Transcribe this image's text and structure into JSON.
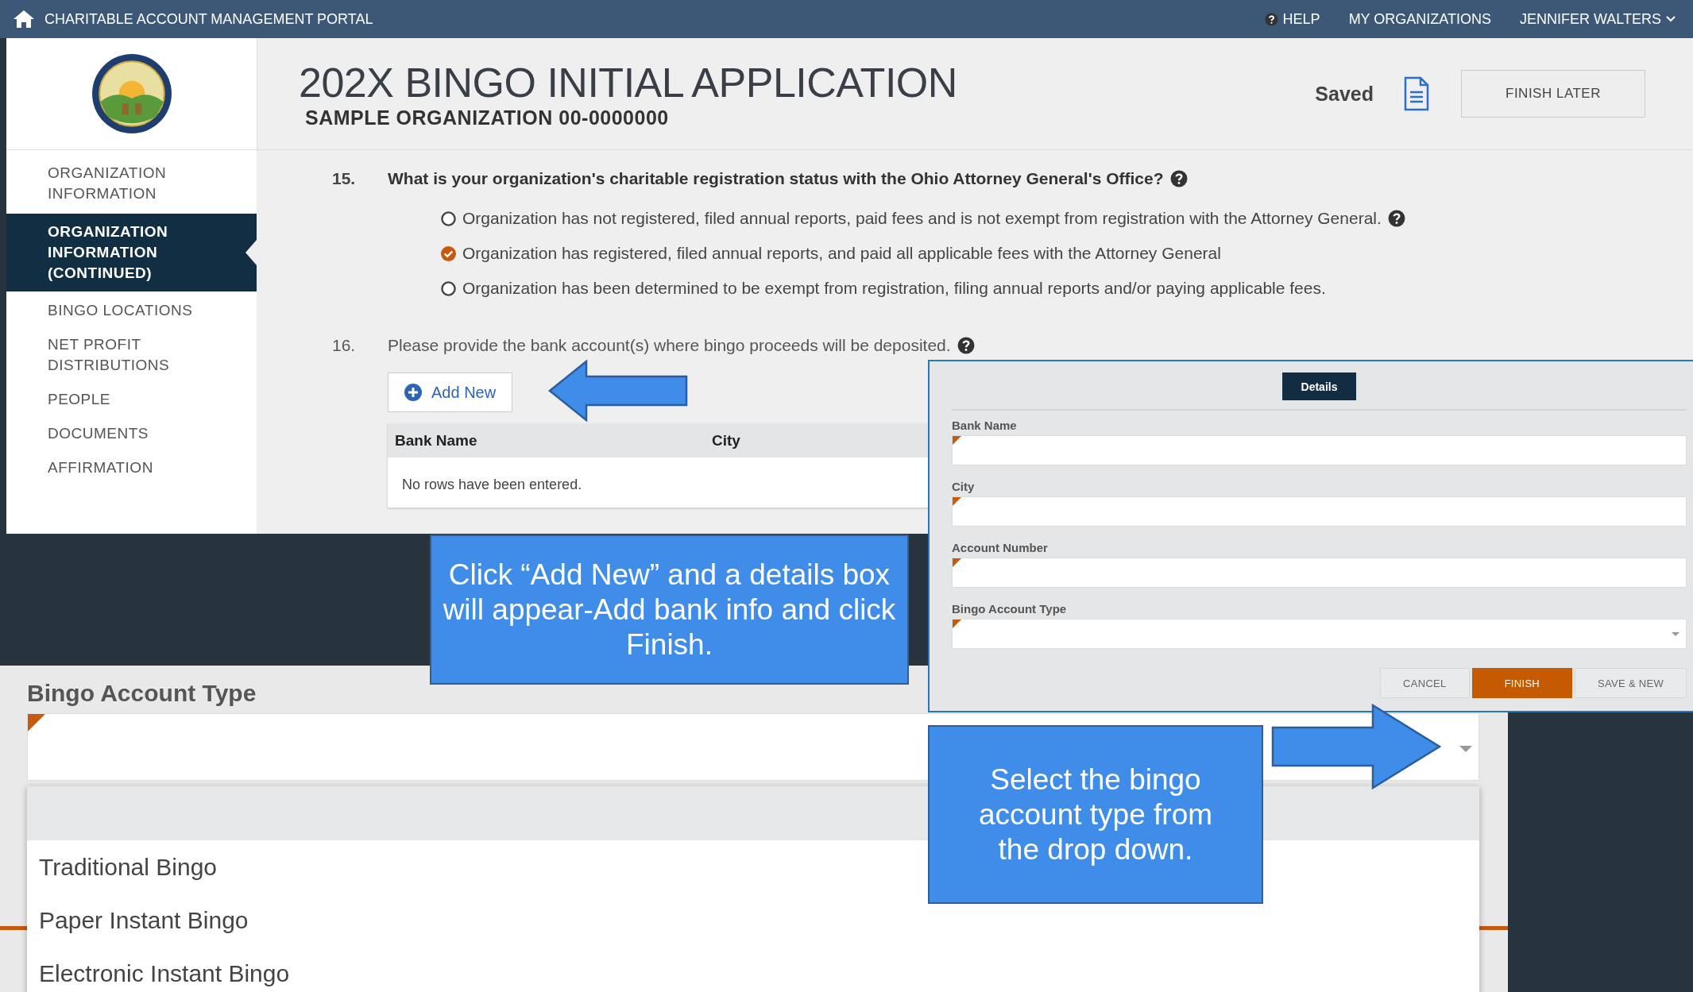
{
  "top_bar": {
    "title": "CHARITABLE ACCOUNT MANAGEMENT PORTAL",
    "help": "HELP",
    "organizations": "MY ORGANIZATIONS",
    "user": "JENNIFER WALTERS"
  },
  "header": {
    "title": "202X BINGO INITIAL APPLICATION",
    "subtitle": "SAMPLE ORGANIZATION 00-0000000",
    "status": "Saved",
    "button": "FINISH LATER"
  },
  "sidebar": {
    "items": [
      {
        "label": "ORGANIZATION INFORMATION",
        "selected": false
      },
      {
        "label": "ORGANIZATION INFORMATION (CONTINUED)",
        "selected": true
      },
      {
        "label": "BINGO LOCATIONS",
        "selected": false
      },
      {
        "label": "NET PROFIT DISTRIBUTIONS",
        "selected": false
      },
      {
        "label": "PEOPLE",
        "selected": false
      },
      {
        "label": "DOCUMENTS",
        "selected": false
      },
      {
        "label": "AFFIRMATION",
        "selected": false
      }
    ]
  },
  "registration_question": {
    "number": "15.",
    "text": "What is your organization's charitable registration status with the Ohio Attorney General's Office?",
    "options": [
      {
        "label": "Organization has not registered, filed annual reports, paid fees and is not exempt from registration with the Attorney General.",
        "selected": false,
        "help": true
      },
      {
        "label": "Organization has registered, filed annual reports, and paid all applicable fees with the Attorney General",
        "selected": true,
        "help": false
      },
      {
        "label": "Organization has been determined to be exempt from registration, filing annual reports and/or paying applicable fees.",
        "selected": false,
        "help": false
      }
    ]
  },
  "bank_question": {
    "number": "16.",
    "text": "Please provide the bank account(s) where bingo proceeds will be deposited.",
    "add_button": "Add New",
    "table": {
      "columns": [
        "Bank Name",
        "City"
      ],
      "empty_message": "No rows have been entered."
    }
  },
  "details_panel": {
    "tab": "Details",
    "fields": [
      {
        "label": "Bank Name",
        "kind": "text",
        "required": true
      },
      {
        "label": "City",
        "kind": "text",
        "required": true
      },
      {
        "label": "Account Number",
        "kind": "text",
        "required": true
      },
      {
        "label": "Bingo Account Type",
        "kind": "select",
        "required": true
      }
    ],
    "buttons": [
      {
        "label": "CANCEL",
        "primary": false
      },
      {
        "label": "FINISH",
        "primary": true
      },
      {
        "label": "SAVE & NEW",
        "primary": false
      }
    ]
  },
  "callouts": [
    {
      "text": "Click “Add New” and a details box will appear-Add bank info and click Finish."
    },
    {
      "text": "Select the bingo account type from the drop down."
    }
  ],
  "dropdown_zoom": {
    "label": "Bingo Account Type",
    "required": true,
    "options": [
      "Traditional Bingo",
      "Paper Instant Bingo",
      "Electronic Instant Bingo"
    ]
  }
}
